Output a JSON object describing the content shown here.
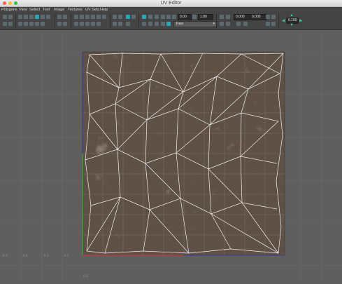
{
  "window": {
    "title": "UV Editor"
  },
  "menus": [
    "Polygons",
    "View",
    "Select",
    "Tool",
    "Image",
    "Textures",
    "UV Sets",
    "Help"
  ],
  "toolbar": {
    "exposure_value": "0.00",
    "gamma_value": "1.00",
    "colorspace_value": "Raw",
    "u_value": "0.000",
    "v_value": "0.000",
    "step_value": "0.100"
  },
  "grid_labels": {
    "left": [
      "-0.6",
      "-0.4",
      "-0.2",
      "-0.1"
    ],
    "bottom": "0.1"
  },
  "colors": {
    "u_axis": "#b04040",
    "v_axis": "#3aa03a",
    "background": "#5f5f5f",
    "texture_dark": "#3a2f28",
    "texture_light": "#7a6a58",
    "uv_wire": "#f2f2f2"
  },
  "icons": [
    "select-tool-icon",
    "lasso-icon",
    "move-icon",
    "rotate-icon",
    "scale-icon",
    "cut-icon",
    "sew-icon",
    "unfold-icon",
    "layout-icon",
    "align-icon",
    "distribute-icon",
    "checker-icon",
    "grid-icon",
    "snap-icon",
    "shaded-icon",
    "exposure-icon",
    "gamma-icon",
    "colorspace-icon",
    "uv-transform-icon",
    "step-arrows-icon"
  ]
}
